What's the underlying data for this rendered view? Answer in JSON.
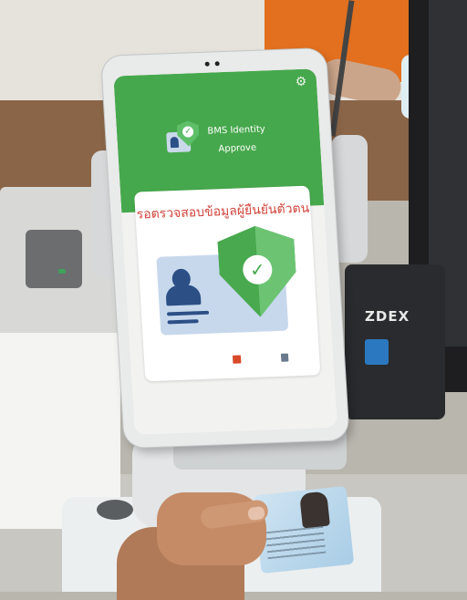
{
  "tablet_app": {
    "app_name_line1": "BMS Identity",
    "app_name_line2": "Approve",
    "status_message": "รอตรวจสอบข้อมูลผู้ยืนยันตัวตน",
    "settings_icon": "gear-icon",
    "colors": {
      "header_green": "#46a84c",
      "status_red": "#d2443c",
      "id_blue": "#2c4f86"
    }
  },
  "scene": {
    "printer_label": "ZDEX"
  }
}
